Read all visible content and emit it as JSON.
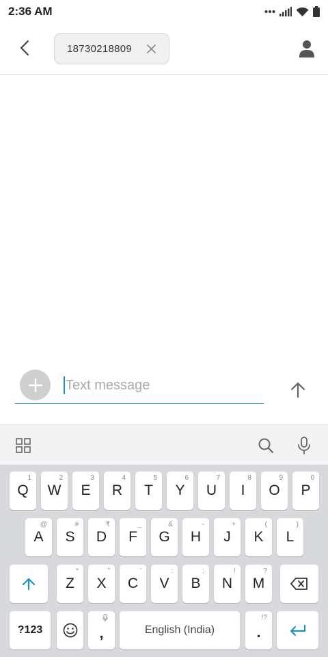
{
  "status_bar": {
    "time": "2:36 AM"
  },
  "header": {
    "recipient_number": "18730218809"
  },
  "compose": {
    "placeholder": "Text message"
  },
  "keyboard": {
    "rows": [
      [
        {
          "label": "Q",
          "hint": "1"
        },
        {
          "label": "W",
          "hint": "2"
        },
        {
          "label": "E",
          "hint": "3"
        },
        {
          "label": "R",
          "hint": "4"
        },
        {
          "label": "T",
          "hint": "5"
        },
        {
          "label": "Y",
          "hint": "6"
        },
        {
          "label": "U",
          "hint": "7"
        },
        {
          "label": "I",
          "hint": "8"
        },
        {
          "label": "O",
          "hint": "9"
        },
        {
          "label": "P",
          "hint": "0"
        }
      ],
      [
        {
          "label": "A",
          "hint": "@"
        },
        {
          "label": "S",
          "hint": "#"
        },
        {
          "label": "D",
          "hint": "₹"
        },
        {
          "label": "F",
          "hint": "_"
        },
        {
          "label": "G",
          "hint": "&"
        },
        {
          "label": "H",
          "hint": "-"
        },
        {
          "label": "J",
          "hint": "+"
        },
        {
          "label": "K",
          "hint": "("
        },
        {
          "label": "L",
          "hint": ")"
        }
      ],
      [
        {
          "label": "Z",
          "hint": "*"
        },
        {
          "label": "X",
          "hint": "\""
        },
        {
          "label": "C",
          "hint": "'"
        },
        {
          "label": "V",
          "hint": ":"
        },
        {
          "label": "B",
          "hint": ";"
        },
        {
          "label": "N",
          "hint": "!"
        },
        {
          "label": "M",
          "hint": "?"
        }
      ]
    ],
    "symbols_label": "?123",
    "comma_label": ",",
    "space_label": "English (India)",
    "period_label": ".",
    "period_hint": "!?"
  },
  "colors": {
    "accent": "#26b0b6",
    "key_icon_blue": "#1e90c8",
    "keyboard_bg": "#d8d9dc"
  },
  "icons": [
    "back-arrow-icon",
    "close-icon",
    "contact-icon",
    "plus-icon",
    "send-arrow-icon",
    "grid-icon",
    "search-icon",
    "mic-icon",
    "shift-icon",
    "backspace-icon",
    "emoji-icon",
    "enter-icon"
  ]
}
